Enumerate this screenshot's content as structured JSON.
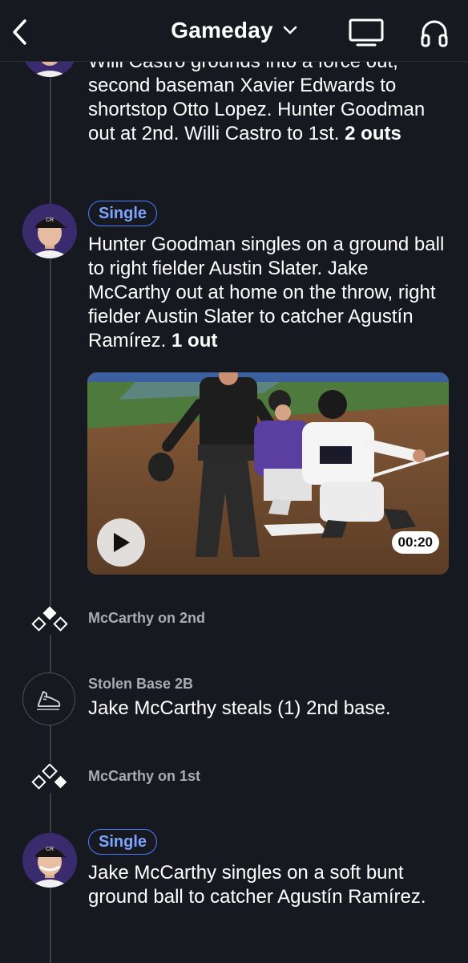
{
  "header": {
    "title": "Gameday",
    "back_icon": "chevron-left-icon",
    "dropdown_icon": "chevron-down-icon",
    "tv_icon": "tv-icon",
    "audio_icon": "headphones-icon"
  },
  "colors": {
    "background": "#161a20",
    "badge_blue": "#4f7dff",
    "secondary_text": "#a9adb3",
    "team_purple": "#3a2a6e"
  },
  "events": [
    {
      "desc_plain": "Willi Castro grounds into a force out, second baseman Xavier Edwards to shortstop Otto Lopez. Hunter Goodman out at 2nd. Willi Castro to 1st.",
      "desc_bold": "2 outs"
    },
    {
      "badge": "Single",
      "desc_plain": "Hunter Goodman singles on a ground ball to right fielder Austin Slater. Jake McCarthy out at home on the throw, right fielder Austin Slater to catcher Agustín Ramírez.",
      "desc_bold": "1 out",
      "video": {
        "duration": "00:20",
        "play_icon": "play-icon"
      }
    },
    {
      "runner": "McCarthy on 2nd",
      "icon": "bases-diamond-icon"
    },
    {
      "label": "Stolen Base 2B",
      "desc": "Jake McCarthy steals (1) 2nd base.",
      "icon": "running-shoe-icon"
    },
    {
      "runner": "McCarthy on 1st",
      "icon": "bases-diamond-icon"
    },
    {
      "badge": "Single",
      "desc": "Jake McCarthy singles on a soft bunt ground ball to catcher Agustín Ramírez."
    }
  ]
}
